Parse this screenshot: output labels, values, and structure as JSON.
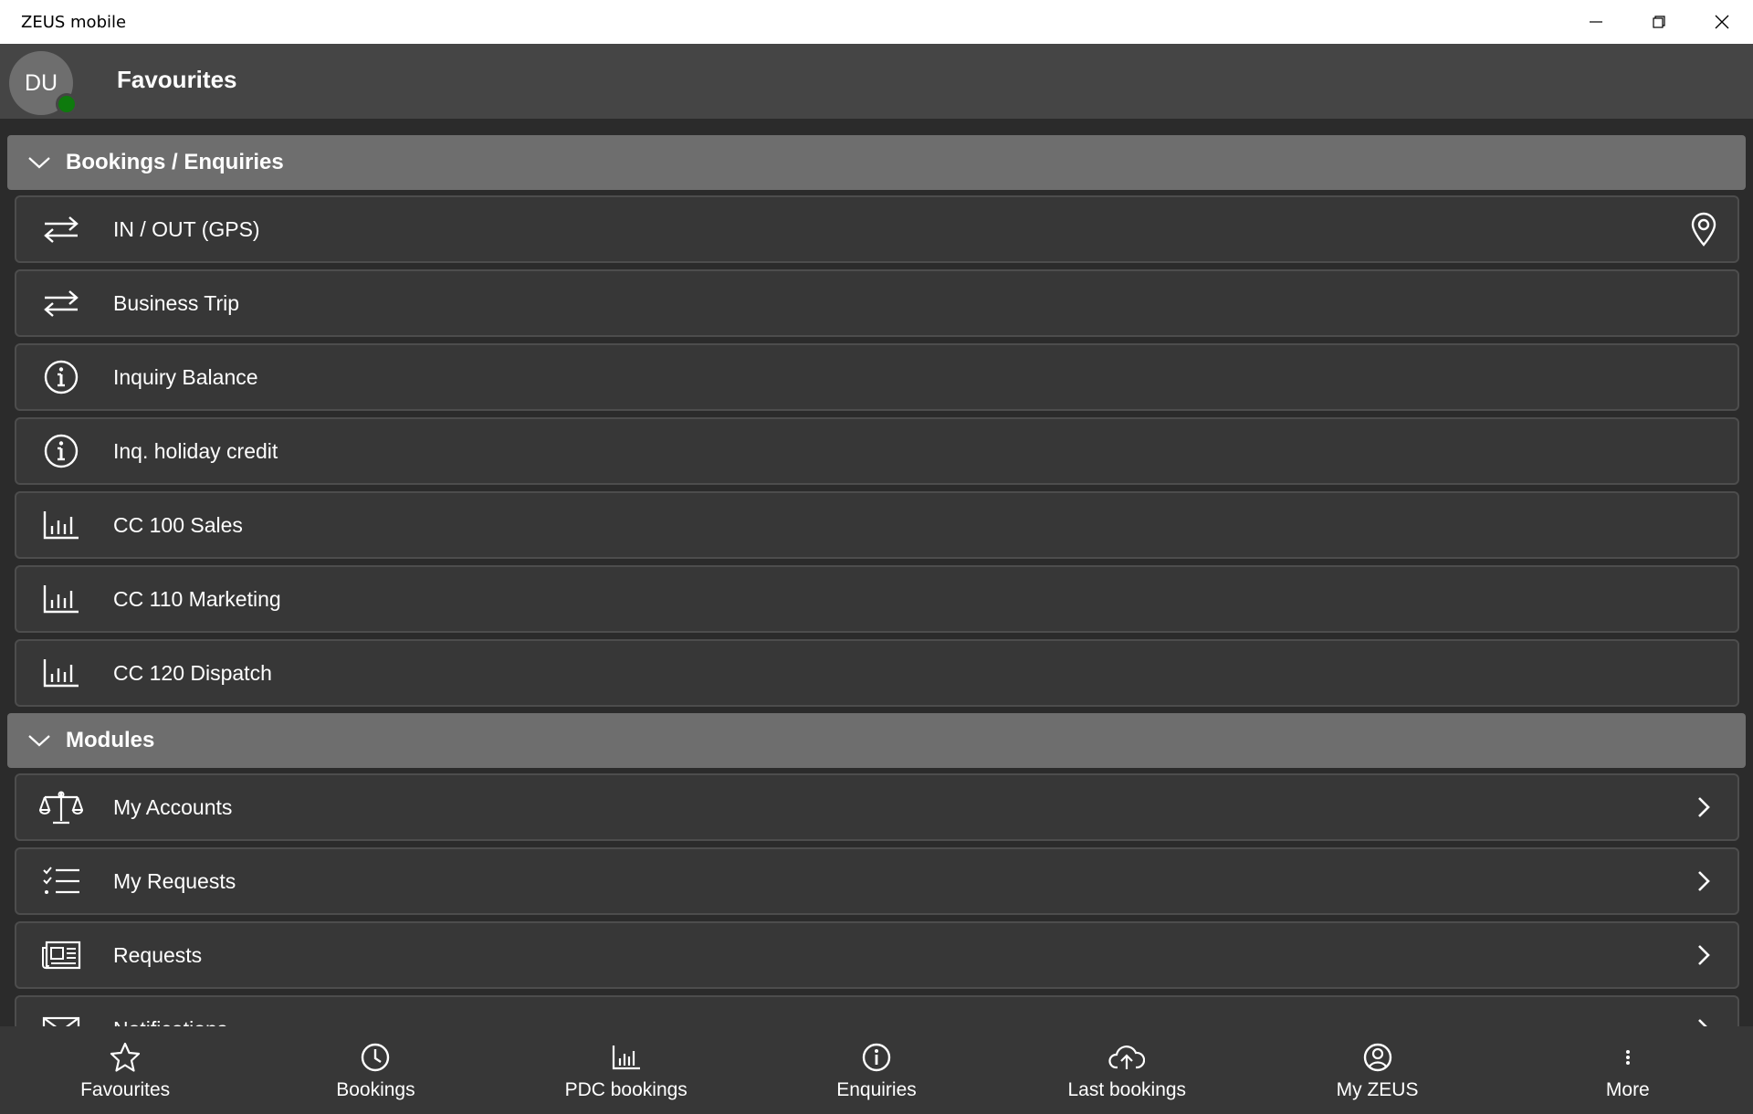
{
  "window": {
    "title": "ZEUS mobile"
  },
  "header": {
    "avatar_initials": "DU",
    "title": "Favourites"
  },
  "sections": [
    {
      "label": "Bookings / Enquiries",
      "items": [
        {
          "label": "IN / OUT  (GPS)",
          "icon": "arrows-swap-icon",
          "trailing": "location-pin-icon"
        },
        {
          "label": "Business Trip",
          "icon": "arrows-swap-icon"
        },
        {
          "label": "Inquiry Balance",
          "icon": "info-icon"
        },
        {
          "label": "Inq. holiday credit",
          "icon": "info-icon"
        },
        {
          "label": "CC 100 Sales",
          "icon": "bar-chart-icon"
        },
        {
          "label": "CC 110 Marketing",
          "icon": "bar-chart-icon"
        },
        {
          "label": "CC 120 Dispatch",
          "icon": "bar-chart-icon"
        }
      ]
    },
    {
      "label": "Modules",
      "items": [
        {
          "label": "My Accounts",
          "icon": "scales-icon",
          "trailing": "chevron-right-icon"
        },
        {
          "label": "My Requests",
          "icon": "checklist-icon",
          "trailing": "chevron-right-icon"
        },
        {
          "label": "Requests",
          "icon": "newspaper-icon",
          "trailing": "chevron-right-icon"
        },
        {
          "label": "Notifications",
          "icon": "mail-icon",
          "trailing": "chevron-right-icon"
        }
      ]
    }
  ],
  "bottom_nav": [
    {
      "label": "Favourites",
      "icon": "star-icon"
    },
    {
      "label": "Bookings",
      "icon": "clock-icon"
    },
    {
      "label": "PDC bookings",
      "icon": "bar-chart-icon"
    },
    {
      "label": "Enquiries",
      "icon": "info-icon"
    },
    {
      "label": "Last bookings",
      "icon": "cloud-upload-icon"
    },
    {
      "label": "My ZEUS",
      "icon": "user-circle-icon"
    },
    {
      "label": "More",
      "icon": "more-vertical-icon"
    }
  ],
  "colors": {
    "presence": "#0e7a0d",
    "section_header": "#6e6e6e",
    "item_bg": "#373737"
  }
}
